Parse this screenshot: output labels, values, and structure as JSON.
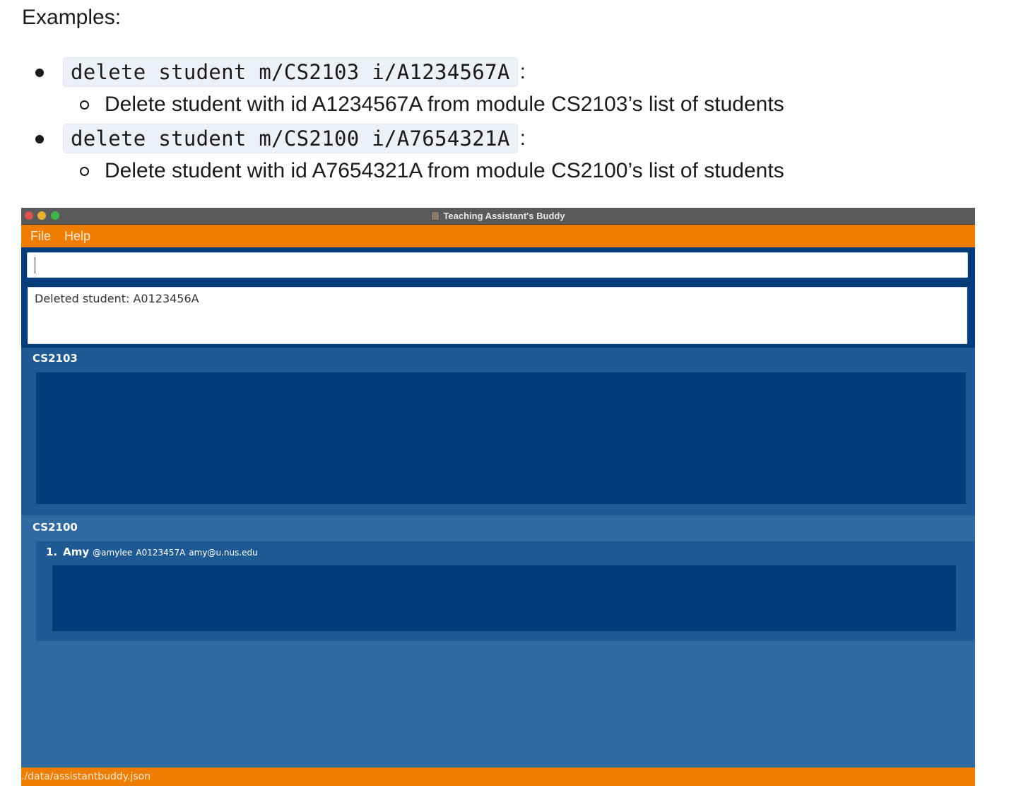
{
  "doc": {
    "heading": "Examples:",
    "examples": [
      {
        "command": "delete student m/CS2103 i/A1234567A",
        "colon": ":",
        "description": "Delete student with id A1234567A from module CS2103’s list of students"
      },
      {
        "command": "delete student m/CS2100 i/A7654321A",
        "colon": ":",
        "description": "Delete student with id A7654321A from module CS2100’s list of students"
      }
    ]
  },
  "app": {
    "window_title": "Teaching Assistant's Buddy",
    "menu": [
      "File",
      "Help"
    ],
    "command_box": {
      "value": ""
    },
    "result_display": "Deleted student: A0123456A",
    "modules": [
      {
        "name": "CS2103",
        "students": []
      },
      {
        "name": "CS2100",
        "students": [
          {
            "index": "1.",
            "name": "Amy",
            "telegram": "@amylee",
            "id": "A0123457A",
            "email": "amy@u.nus.edu"
          }
        ]
      }
    ],
    "status_bar": "./data/assistantbuddy.json"
  },
  "colors": {
    "accent": "#ef7d00",
    "dark_blue": "#003d7a",
    "mid_blue": "#1f5a95",
    "light_blue": "#2f6aa0"
  }
}
